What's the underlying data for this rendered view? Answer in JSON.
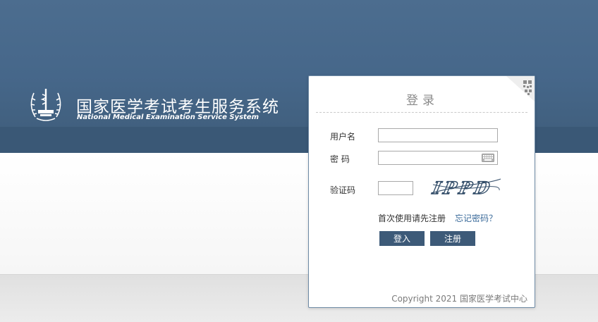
{
  "header": {
    "title": "国家医学考试考生服务系统",
    "subtitle": "National Medical Examination Service System"
  },
  "login": {
    "title": "登录",
    "username_label": "用户名",
    "password_label": "密 码",
    "captcha_label": "验证码",
    "captcha_text": "IPPD",
    "first_use_text": "首次使用请先注册",
    "forgot_password_link": "忘记密码？",
    "login_button": "登入",
    "register_button": "注册",
    "username_value": "",
    "password_value": "",
    "captcha_value": ""
  },
  "footer": {
    "copyright": "Copyright 2021 国家医学考试中心"
  },
  "icons": {
    "emblem": "medical-staff-emblem-icon",
    "qr": "qr-code-icon",
    "keyboard": "keyboard-icon"
  },
  "colors": {
    "banner": "#46678a",
    "banner_strip": "#3a5876",
    "button": "#3d5a78",
    "link": "#3a6a9a"
  }
}
